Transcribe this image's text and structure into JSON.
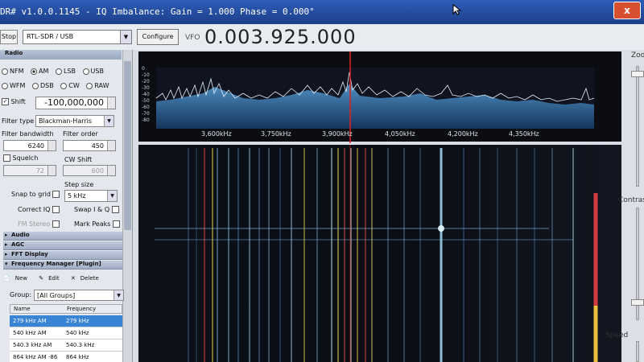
{
  "window": {
    "title": "DR# v1.0.0.1145 - IQ Imbalance: Gain = 1.000 Phase = 0.000°",
    "close_label": "x"
  },
  "toolbar": {
    "stop_label": "Stop",
    "source_value": "RTL-SDR / USB",
    "configure_label": "Configure",
    "vfo_label": "VFO",
    "vfo_value": "0.003.925.000"
  },
  "radio_panel": {
    "header": "Radio",
    "modes_row1": [
      "NFM",
      "AM",
      "LSB",
      "USB"
    ],
    "modes_row2": [
      "WFM",
      "DSB",
      "CW",
      "RAW"
    ],
    "selected_mode": "AM",
    "shift_label": "Shift",
    "shift_value": "-100,000,000",
    "filter_type_label": "Filter type",
    "filter_type_value": "Blackman-Harris",
    "filter_bandwidth_label": "Filter bandwidth",
    "filter_bandwidth_value": "6240",
    "filter_order_label": "Filter order",
    "filter_order_value": "450",
    "squelch_label": "Squelch",
    "squelch_value": "72",
    "cw_shift_label": "CW Shift",
    "cw_shift_value": "600",
    "step_size_label": "Step size",
    "snap_to_grid_label": "Snap to grid",
    "step_size_value": "5 kHz",
    "correct_iq_label": "Correct IQ",
    "swap_iq_label": "Swap I & Q",
    "fm_stereo_label": "FM Stereo",
    "mark_peaks_label": "Mark Peaks"
  },
  "sections": [
    "Audio",
    "AGC",
    "FFT Display",
    "Frequency Manager [Plugin]"
  ],
  "freq_manager": {
    "new_label": "New",
    "edit_label": "Edit",
    "delete_label": "Delete",
    "group_label": "Group:",
    "group_value": "[All Groups]",
    "columns": [
      "Name",
      "Frequency"
    ],
    "rows": [
      {
        "name": "279 kHz AM",
        "freq": "279 kHz"
      },
      {
        "name": "540 kHz AM",
        "freq": "540 kHz"
      },
      {
        "name": "540.3 kHz AM",
        "freq": "540.3 kHz"
      },
      {
        "name": "864 kHz AM -86",
        "freq": "864 kHz"
      }
    ]
  },
  "spectrum": {
    "y_ticks": [
      "0",
      "-10",
      "-20",
      "-30",
      "-40",
      "-50",
      "-60",
      "-70",
      "-80"
    ],
    "x_ticks": [
      "3,600kHz",
      "3,750kHz",
      "3,900kHz",
      "4,050kHz",
      "4,200kHz",
      "4,350kHz"
    ]
  },
  "right_panel": {
    "zoom_label": "Zoo",
    "contrast_label": "Contras",
    "speed_label": "Speed"
  },
  "colors": {
    "title_bar": "#2e5db8",
    "spectrum_bg": "#0c0d12",
    "spectrum_fill": "#2a6fb0",
    "center_line": "#e02020",
    "selected_row": "#3a84d6"
  }
}
